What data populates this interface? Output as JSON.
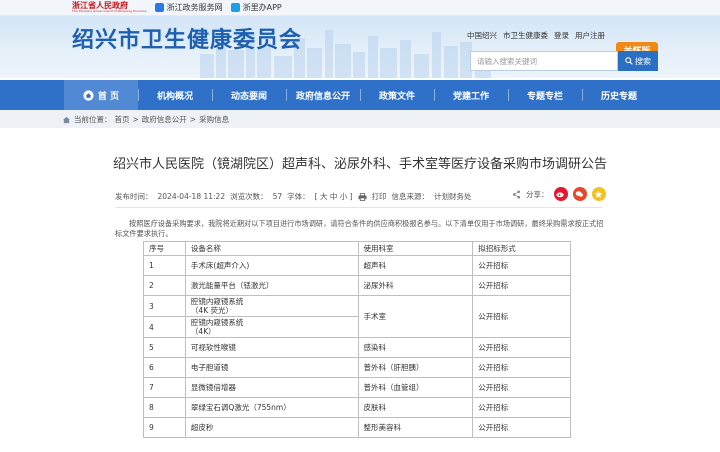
{
  "topbar": {
    "gov_name": "浙江省人民政府",
    "gov_name_en": "The People's Government of Zhejiang Province",
    "links": [
      "浙江政务服务网",
      "浙里办APP"
    ]
  },
  "header": {
    "site_title": "绍兴市卫生健康委员会",
    "top_links": [
      "中国绍兴",
      "市卫生健康委",
      "登录",
      "用户注册"
    ],
    "care_mode": "关怀版",
    "search_placeholder": "请输入搜索关键词",
    "search_button": "搜索"
  },
  "nav": {
    "items": [
      "首  页",
      "机构概况",
      "动态要闻",
      "政府信息公开",
      "政策文件",
      "党建工作",
      "专题专栏",
      "历史专题"
    ]
  },
  "breadcrumb": {
    "label": "当前位置：",
    "items": [
      "首页",
      "政府信息公开",
      "采购信息"
    ],
    "separator": ">"
  },
  "article": {
    "title": "绍兴市人民医院（镜湖院区）超声科、泌尿外科、手术室等医疗设备采购市场调研公告",
    "published_label": "发布时间：",
    "published": "2024-04-18 11:22",
    "views_label": "浏览次数：",
    "views": "57",
    "font_label": "字体：",
    "font_sizes": "[ 大 中 小 ]",
    "print": "打印",
    "source_label": "信息来源：",
    "source": "计划财务处",
    "share_label": "分享：",
    "intro": "按照医疗设备采购要求，我院将近期对以下项目进行市场调研，请符合条件的供应商积极报名参与。以下清单仅用于市场调研，最终采购需求按正式招标文件要求执行。"
  },
  "table": {
    "headers": [
      "序号",
      "设备名称",
      "使用科室",
      "拟招标形式"
    ],
    "rows": [
      {
        "no": "1",
        "name": "手术床(超声介入)",
        "dept": "超声科",
        "form": "公开招标"
      },
      {
        "no": "2",
        "name": "激光能量平台（铥激光）",
        "dept": "泌尿外科",
        "form": "公开招标"
      },
      {
        "no": "3",
        "name_lines": [
          "腔镜内窥镜系统",
          "（4K 荧光）"
        ],
        "dept": "手术室",
        "form": "公开招标"
      },
      {
        "no": "4",
        "name_lines": [
          "腔镜内窥镜系统",
          "（4K）"
        ]
      },
      {
        "no": "5",
        "name": "可视软性喉镜",
        "dept": "感染科",
        "form": "公开招标"
      },
      {
        "no": "6",
        "name": "电子胆道镜",
        "dept": "普外科（肝胆胰）",
        "form": "公开招标"
      },
      {
        "no": "7",
        "name": "显微镜倍增器",
        "dept": "普外科（血管组）",
        "form": "公开招标"
      },
      {
        "no": "8",
        "name": "翠绿宝石调Q激光（755nm）",
        "dept": "皮肤科",
        "form": "公开招标"
      },
      {
        "no": "9",
        "name": "超皮秒",
        "dept": "整形美容科",
        "form": "公开招标"
      }
    ]
  }
}
